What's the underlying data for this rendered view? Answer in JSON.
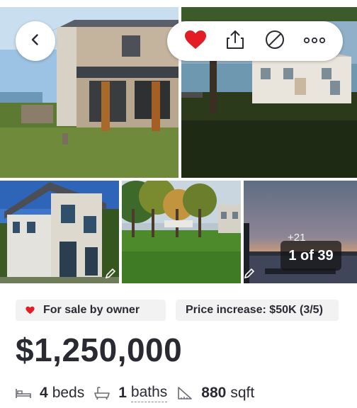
{
  "gallery": {
    "photo_count_label": "1 of 39",
    "more_photos_label": "+21",
    "photos": [
      {
        "name": "house-exterior-rear"
      },
      {
        "name": "house-lakeside-lawn"
      },
      {
        "name": "house-exterior-side"
      },
      {
        "name": "yard-with-trees"
      },
      {
        "name": "lake-sunset"
      }
    ]
  },
  "actions": {
    "icons": [
      "chevron-left-icon",
      "heart-icon",
      "share-icon",
      "hide-icon",
      "more-icon"
    ],
    "heart_color": "#e31c25"
  },
  "listing": {
    "badges": {
      "fsbo_label": "For sale by owner",
      "price_change_label": "Price increase: $50K (3/5)"
    },
    "price": "$1,250,000",
    "beds_value": "4",
    "beds_label": "beds",
    "baths_value": "1",
    "baths_label": "baths",
    "sqft_value": "880",
    "sqft_label": "sqft"
  },
  "colors": {
    "text": "#2a2a33",
    "badge_bg": "#f2f2f2",
    "accent_heart": "#e31c25"
  }
}
